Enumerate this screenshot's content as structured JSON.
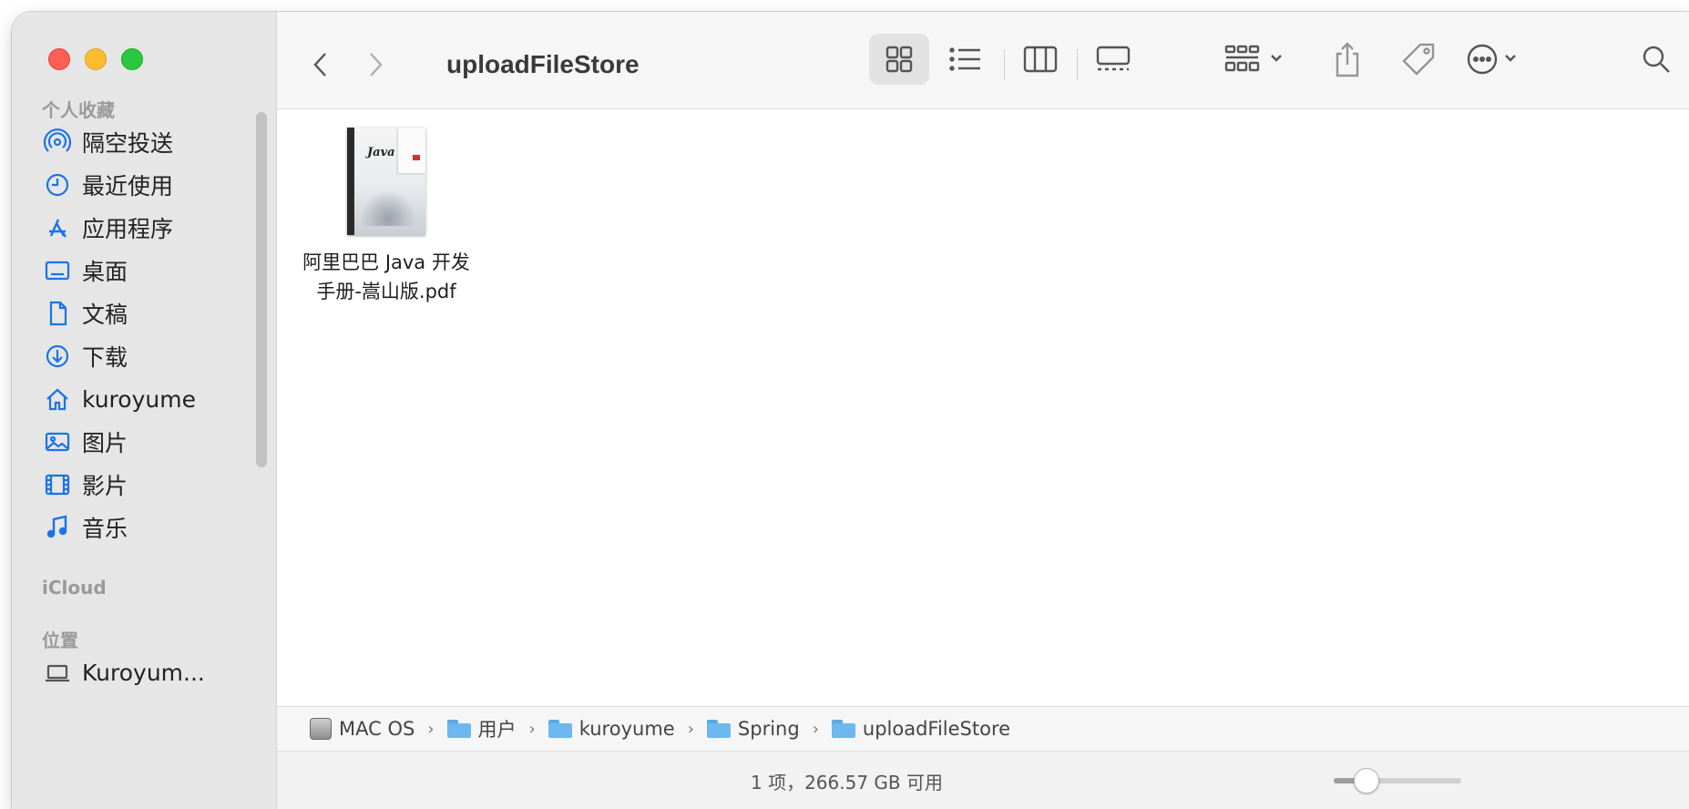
{
  "window": {
    "title": "uploadFileStore"
  },
  "sidebar": {
    "favorites_header": "个人收藏",
    "favorites": [
      {
        "label": "隔空投送",
        "icon": "airdrop-icon"
      },
      {
        "label": "最近使用",
        "icon": "clock-icon"
      },
      {
        "label": "应用程序",
        "icon": "applications-icon"
      },
      {
        "label": "桌面",
        "icon": "desktop-icon"
      },
      {
        "label": "文稿",
        "icon": "document-icon"
      },
      {
        "label": "下载",
        "icon": "download-icon"
      },
      {
        "label": "kuroyume",
        "icon": "home-icon"
      },
      {
        "label": "图片",
        "icon": "photo-icon"
      },
      {
        "label": "影片",
        "icon": "film-icon"
      },
      {
        "label": "音乐",
        "icon": "music-icon"
      }
    ],
    "icloud_header": "iCloud",
    "locations_header": "位置",
    "locations": [
      {
        "label": "Kuroyum...",
        "icon": "laptop-icon"
      }
    ]
  },
  "toolbar": {
    "back": "back-chevron-icon",
    "forward": "forward-chevron-icon",
    "views": [
      "icon-view-icon",
      "list-view-icon",
      "column-view-icon",
      "gallery-view-icon"
    ],
    "active_view": "icon-view",
    "group": "group-icon",
    "share": "share-icon",
    "tag": "tag-icon",
    "more": "more-icon",
    "search": "search-icon"
  },
  "files": [
    {
      "name_line1": "阿里巴巴 Java 开发",
      "name_line2": "手册-嵩山版.pdf",
      "thumb_text": "Java"
    }
  ],
  "pathbar": [
    {
      "label": "MAC OS",
      "icon": "disk-icon"
    },
    {
      "label": "用户",
      "icon": "folder-icon"
    },
    {
      "label": "kuroyume",
      "icon": "folder-icon"
    },
    {
      "label": "Spring",
      "icon": "folder-icon"
    },
    {
      "label": "uploadFileStore",
      "icon": "folder-icon"
    }
  ],
  "status": {
    "text": "1 项，266.57 GB 可用",
    "zoom_level": 0.25
  }
}
